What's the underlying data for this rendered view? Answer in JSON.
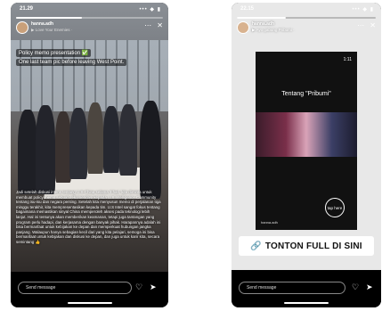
{
  "left_story": {
    "status_time": "21.29",
    "status_icons": "••• ◆ ▮",
    "progress": 0.45,
    "username": "hanna.adh",
    "sublabel": "▶ Love Your Enemies ·",
    "caption_line1": "Policy memo presentation ✅",
    "caption_line2": "One last team pic before leaving West Point.",
    "body_text": "Jadi setelah diskusi intens tentang U.S-China selama 3 hari, kita diminta untuk membuat policy memo sebuah rekomendasi kepada U.S Intelligence Community tentang isu-isu dan negara penting. Setelah kita menyusun memo di perjalanan tiga minggu terakhir, kita mempresentasikan kepada tim. U.S Intel sangat fokus tentang bagaimana memastikan sinyal China memperoleh akses pada teknologi lebih lanjut. Hal ini tentunya akan memberikan keamanan, tetapi juga tantangan yang program perlu hadapi, dan kerjasama dengan banyak pihak. Harapannya adalah ini bisa bermanfaat untuk kebijakan ke depan dan memperkuat hubungan jangka panjang. Walaupun hanya sebagian kecil dari yang kita pelajari, semoga ini bisa bermanfaat untuk kebijakan dan diskusi ke depan, dan juga untuk karir kita, secara semintang 👍",
    "send_placeholder": "Send message"
  },
  "right_story": {
    "status_time": "22.15",
    "status_icons": "••• ◆ ▮",
    "progress": 0.35,
    "username": "hanna.adh",
    "sublabel": "▶ Ayo gabung Pribumi ·",
    "video_time": "1:11",
    "video_title": "Tentang \"Pribumi\"",
    "tap_label": "tap here",
    "video_handle": "hanna.adh",
    "cta_text": "TONTON FULL DI SINI",
    "send_placeholder": "Send message"
  },
  "icons": {
    "more": "⋯",
    "close": "✕",
    "heart": "♡",
    "send": "➤",
    "link": "🔗"
  }
}
